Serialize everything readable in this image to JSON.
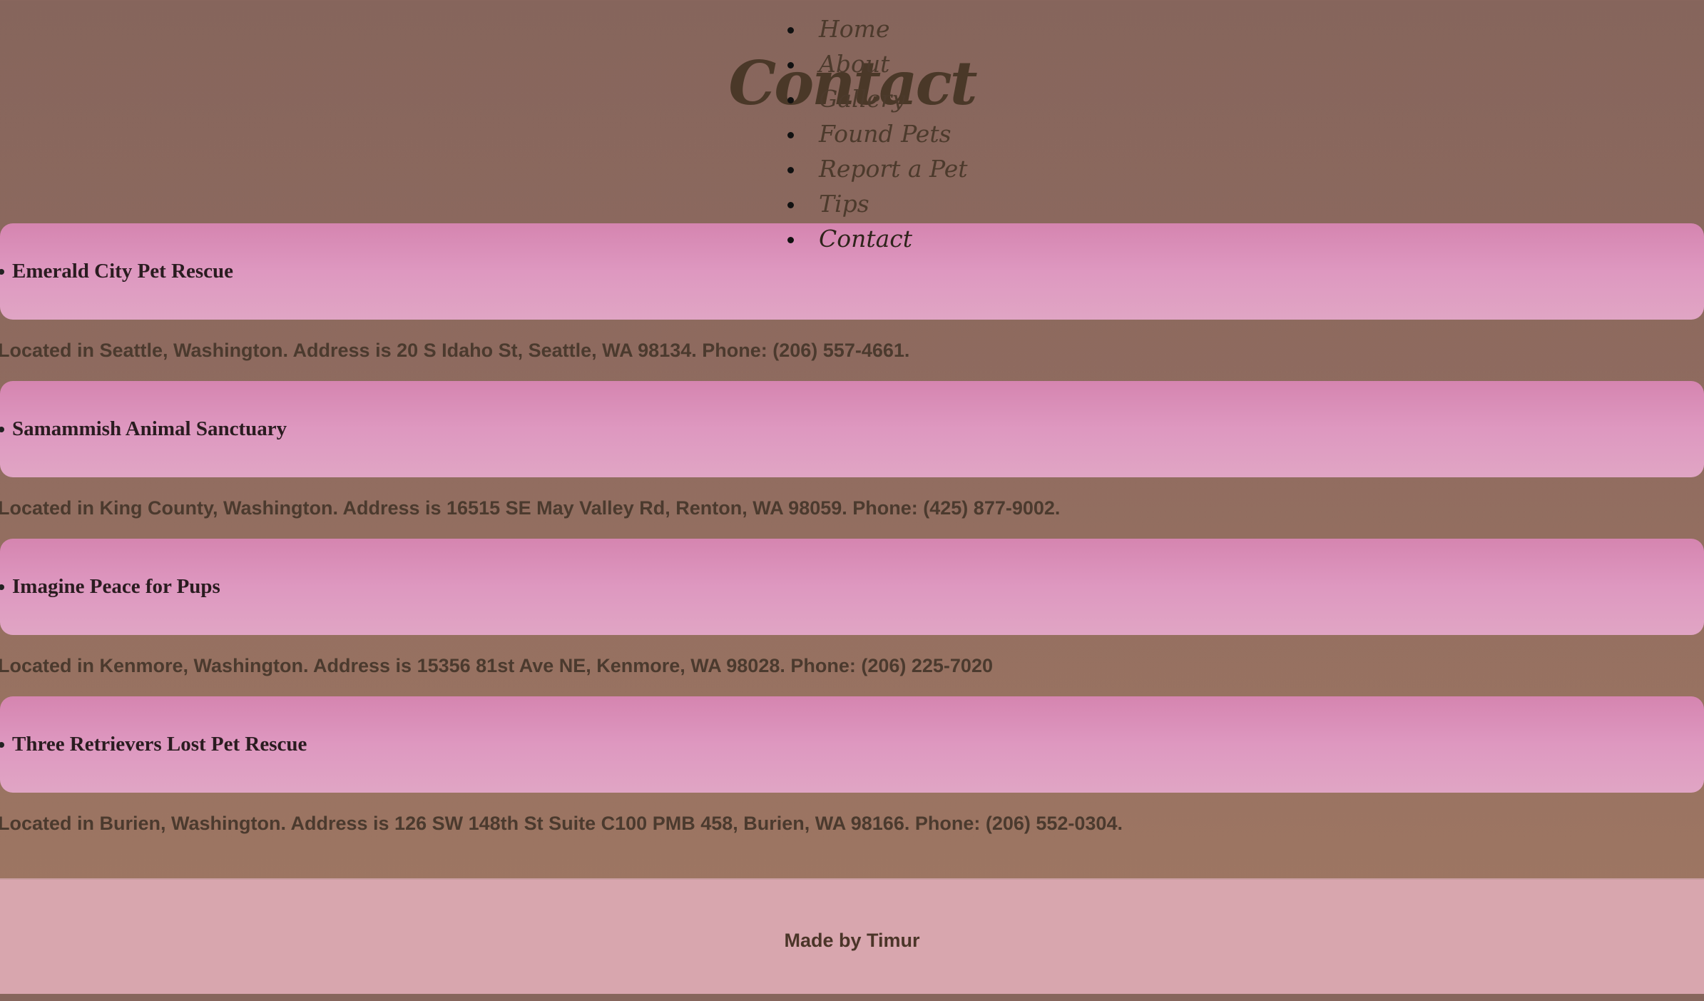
{
  "header": {
    "title": "Contact"
  },
  "nav": {
    "items": [
      {
        "label": "Home"
      },
      {
        "label": "About"
      },
      {
        "label": "Gallery"
      },
      {
        "label": "Found Pets"
      },
      {
        "label": "Report a Pet"
      },
      {
        "label": "Tips"
      },
      {
        "label": "Contact"
      }
    ],
    "active": "Contact"
  },
  "rescues": [
    {
      "name": "Emerald City Pet Rescue",
      "description": "Located in Seattle, Washington. Address is 20 S Idaho St, Seattle, WA 98134. Phone: (206) 557-4661."
    },
    {
      "name": "Samammish Animal Sanctuary",
      "description": "Located in King County, Washington. Address is 16515 SE May Valley Rd, Renton, WA 98059. Phone: (425) 877-9002."
    },
    {
      "name": "Imagine Peace for Pups",
      "description": "Located in Kenmore, Washington. Address is 15356 81st Ave NE, Kenmore, WA 98028. Phone: (206) 225-7020"
    },
    {
      "name": "Three Retrievers Lost Pet Rescue",
      "description": "Located in Burien, Washington. Address is 126 SW 148th St Suite C100 PMB 458, Burien, WA 98166. Phone: (206) 552-0304."
    }
  ],
  "footer": {
    "text": "Made by Timur"
  },
  "colors": {
    "background_top": "#86655c",
    "background_bottom": "#a07663",
    "card_top": "#d585b0",
    "card_bottom": "#e0a5c4",
    "footer": "#d8a6ae",
    "text": "#4b3a2e"
  }
}
